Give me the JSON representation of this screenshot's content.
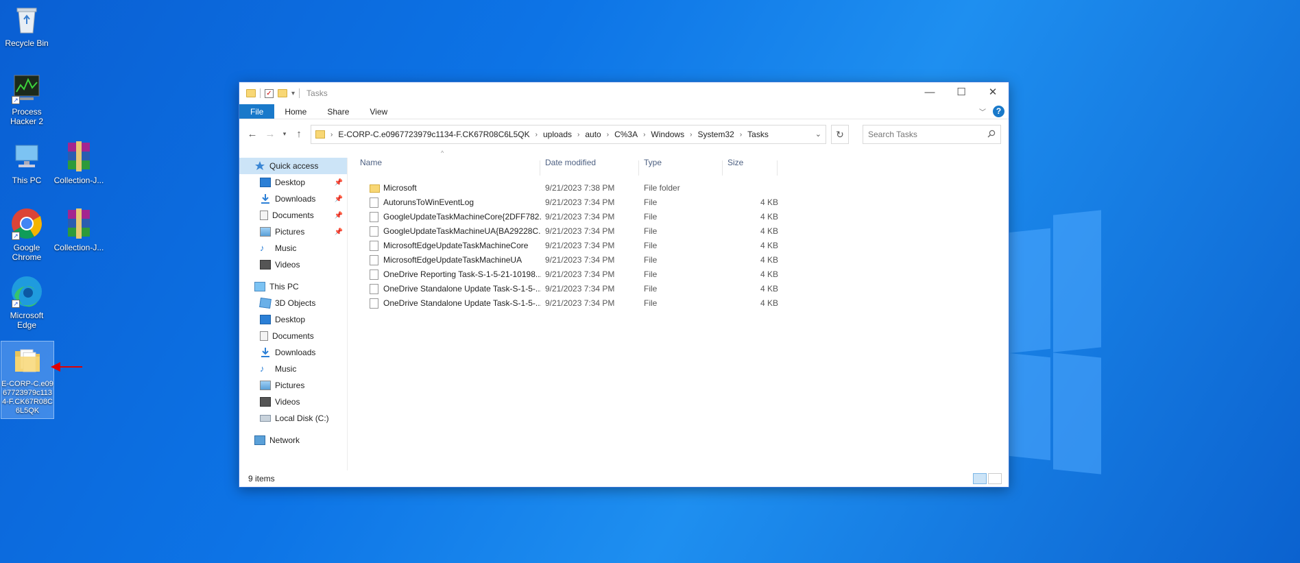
{
  "desktop": {
    "icons": [
      {
        "label": "Recycle Bin",
        "icon": "recycle-bin-icon"
      },
      {
        "label": "Process Hacker 2",
        "icon": "process-hacker-icon"
      },
      {
        "label": "This PC",
        "icon": "this-pc-icon"
      },
      {
        "label": "Collection-J...",
        "icon": "winrar-archive-icon"
      },
      {
        "label": "Google Chrome",
        "icon": "chrome-icon"
      },
      {
        "label": "Collection-J...",
        "icon": "winrar-archive-icon"
      },
      {
        "label": "Microsoft Edge",
        "icon": "edge-icon"
      },
      {
        "label": "E-CORP-C.e0967723979c1134-F.CK67R08C6L5QK",
        "icon": "folder-icon"
      }
    ],
    "annotation_color": "#e00000"
  },
  "window": {
    "title": "Tasks",
    "controls": {
      "minimize": "—",
      "maximize": "☐",
      "close": "✕"
    },
    "ribbon_tabs": [
      "File",
      "Home",
      "Share",
      "View"
    ],
    "help": "?",
    "breadcrumbs": [
      "E-CORP-C.e0967723979c1134-F.CK67R08C6L5QK",
      "uploads",
      "auto",
      "C%3A",
      "Windows",
      "System32",
      "Tasks"
    ],
    "search_placeholder": "Search Tasks",
    "accent": "#1979ca"
  },
  "nav": {
    "quick_access": "Quick access",
    "quick_items": [
      {
        "label": "Desktop",
        "pinned": true
      },
      {
        "label": "Downloads",
        "pinned": true
      },
      {
        "label": "Documents",
        "pinned": true
      },
      {
        "label": "Pictures",
        "pinned": true
      },
      {
        "label": "Music",
        "pinned": false
      },
      {
        "label": "Videos",
        "pinned": false
      }
    ],
    "this_pc": "This PC",
    "pc_items": [
      "3D Objects",
      "Desktop",
      "Documents",
      "Downloads",
      "Music",
      "Pictures",
      "Videos",
      "Local Disk (C:)"
    ],
    "network": "Network"
  },
  "columns": {
    "name": "Name",
    "date": "Date modified",
    "type": "Type",
    "size": "Size"
  },
  "files": [
    {
      "name": "Microsoft",
      "date": "9/21/2023 7:38 PM",
      "type": "File folder",
      "size": "",
      "kind": "folder"
    },
    {
      "name": "AutorunsToWinEventLog",
      "date": "9/21/2023 7:34 PM",
      "type": "File",
      "size": "4 KB",
      "kind": "file"
    },
    {
      "name": "GoogleUpdateTaskMachineCore{2DFF782...",
      "date": "9/21/2023 7:34 PM",
      "type": "File",
      "size": "4 KB",
      "kind": "file"
    },
    {
      "name": "GoogleUpdateTaskMachineUA{BA29228C...",
      "date": "9/21/2023 7:34 PM",
      "type": "File",
      "size": "4 KB",
      "kind": "file"
    },
    {
      "name": "MicrosoftEdgeUpdateTaskMachineCore",
      "date": "9/21/2023 7:34 PM",
      "type": "File",
      "size": "4 KB",
      "kind": "file"
    },
    {
      "name": "MicrosoftEdgeUpdateTaskMachineUA",
      "date": "9/21/2023 7:34 PM",
      "type": "File",
      "size": "4 KB",
      "kind": "file"
    },
    {
      "name": "OneDrive Reporting Task-S-1-5-21-10198...",
      "date": "9/21/2023 7:34 PM",
      "type": "File",
      "size": "4 KB",
      "kind": "file"
    },
    {
      "name": "OneDrive Standalone Update Task-S-1-5-...",
      "date": "9/21/2023 7:34 PM",
      "type": "File",
      "size": "4 KB",
      "kind": "file"
    },
    {
      "name": "OneDrive Standalone Update Task-S-1-5-...",
      "date": "9/21/2023 7:34 PM",
      "type": "File",
      "size": "4 KB",
      "kind": "file"
    }
  ],
  "status": {
    "count": "9 items"
  }
}
